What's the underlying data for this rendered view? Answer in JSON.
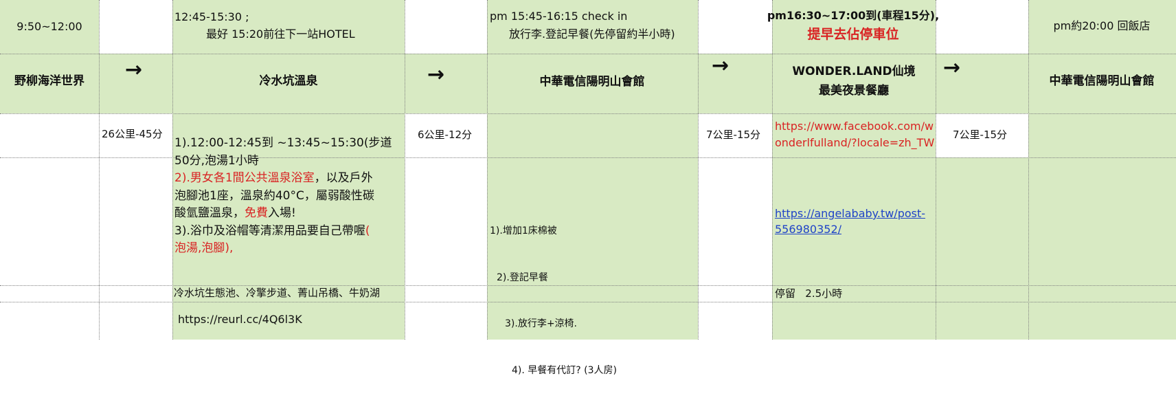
{
  "sheet": {
    "top_row": {
      "time_1": "9:50~12:00",
      "time_2_line_1": "12:45-15:30 ;",
      "time_2_line_2": "最好 15:20前往下一站HOTEL",
      "time_3_line_1": "pm 15:45-16:15 check in",
      "time_3_line_2": "放行李.登記早餐(先停留約半小時)",
      "time_4_line_1": "pm16:30~17:00到(車程15分),",
      "time_4_line_2": "提早去佔停車位",
      "time_5": "pm約20:00 回飯店"
    },
    "main_row": {
      "stop_1": "野柳海洋世界",
      "stop_2": "冷水坑溫泉",
      "stop_3": "中華電信陽明山會館",
      "stop_4_line_1": "WONDER.LAND仙境",
      "stop_4_line_2": "最美夜景餐廳",
      "stop_5": "中華電信陽明山會館",
      "arrow_1": "→",
      "arrow_2": "→",
      "arrow_3": "→",
      "arrow_4": "→"
    },
    "distance_row": {
      "distance_1": "26公里-45分",
      "distance_2": "6公里-12分",
      "distance_3": "7公里-15分",
      "distance_4": "7公里-15分",
      "facebook_line_1": "https://www.facebook.com/w",
      "facebook_line_2": "onderlfulland/?locale=zh_TW"
    },
    "hot_spring_details": {
      "line_1": "1).12:00-12:45到 ~13:45~15:30(步道",
      "line_2": "50分,泡湯1小時",
      "line_3_red": "2).男女各1間公共溫泉浴室",
      "line_3_black": "，以及戶外",
      "line_4": "泡腳池1座，溫泉約40°C，屬弱酸性碳",
      "line_5_black_1": "酸氫鹽溫泉，",
      "line_5_red": "免費",
      "line_5_black_2": "入場!",
      "line_6_black": "3).浴巾及浴帽等清潔用品要自己帶喔",
      "line_6_red": "(",
      "line_7_red": "泡湯,泡腳),"
    },
    "hotel_details": {
      "item_1": "1).增加1床棉被",
      "item_2": "2).登記早餐",
      "item_3": "3).放行李+涼椅.",
      "item_4": "4). 早餐有代訂? (3人房)"
    },
    "restaurant_details": {
      "link_line_1": "https://angelababy.tw/post-",
      "link_line_2": "556980352/"
    },
    "lower_rows": {
      "nearby": "冷水坑生態池、冷擎步道、菁山吊橋、牛奶湖",
      "stay": "停留   2.5小時",
      "short_link": "https://reurl.cc/4Q6l3K"
    },
    "colors": {
      "green_fill": "#d8eac3",
      "red_text": "#d92323",
      "blue_link": "#1f43c7",
      "grid": "#7f7f7f"
    }
  }
}
